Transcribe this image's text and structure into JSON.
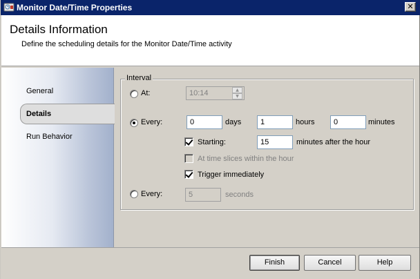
{
  "window": {
    "title": "Monitor Date/Time Properties",
    "close_glyph": "✕"
  },
  "header": {
    "title": "Details Information",
    "subtitle": "Define the scheduling details for the Monitor Date/Time activity"
  },
  "nav": {
    "items": [
      {
        "label": "General",
        "selected": false
      },
      {
        "label": "Details",
        "selected": true
      },
      {
        "label": "Run Behavior",
        "selected": false
      }
    ]
  },
  "interval": {
    "legend": "Interval",
    "at": {
      "label": "At:",
      "selected": false,
      "time_value": "10:14",
      "enabled": false
    },
    "every": {
      "label": "Every:",
      "selected": true,
      "days_value": "0",
      "days_label": "days",
      "hours_value": "1",
      "hours_label": "hours",
      "minutes_value": "0",
      "minutes_label": "minutes"
    },
    "starting": {
      "label": "Starting:",
      "checked": true,
      "value": "15",
      "suffix": "minutes after the hour"
    },
    "time_slices": {
      "label": "At time slices within the hour",
      "checked": false,
      "enabled": false
    },
    "trigger": {
      "label": "Trigger immediately",
      "checked": true
    },
    "every_seconds": {
      "label": "Every:",
      "selected": false,
      "value": "5",
      "suffix": "seconds",
      "enabled": false
    }
  },
  "buttons": {
    "finish": "Finish",
    "cancel": "Cancel",
    "help": "Help"
  },
  "colors": {
    "titlebar": "#0a246a",
    "dialog_bg": "#d4d0c8"
  },
  "icons": {
    "app": "monitor-app-icon",
    "close": "close-icon"
  }
}
